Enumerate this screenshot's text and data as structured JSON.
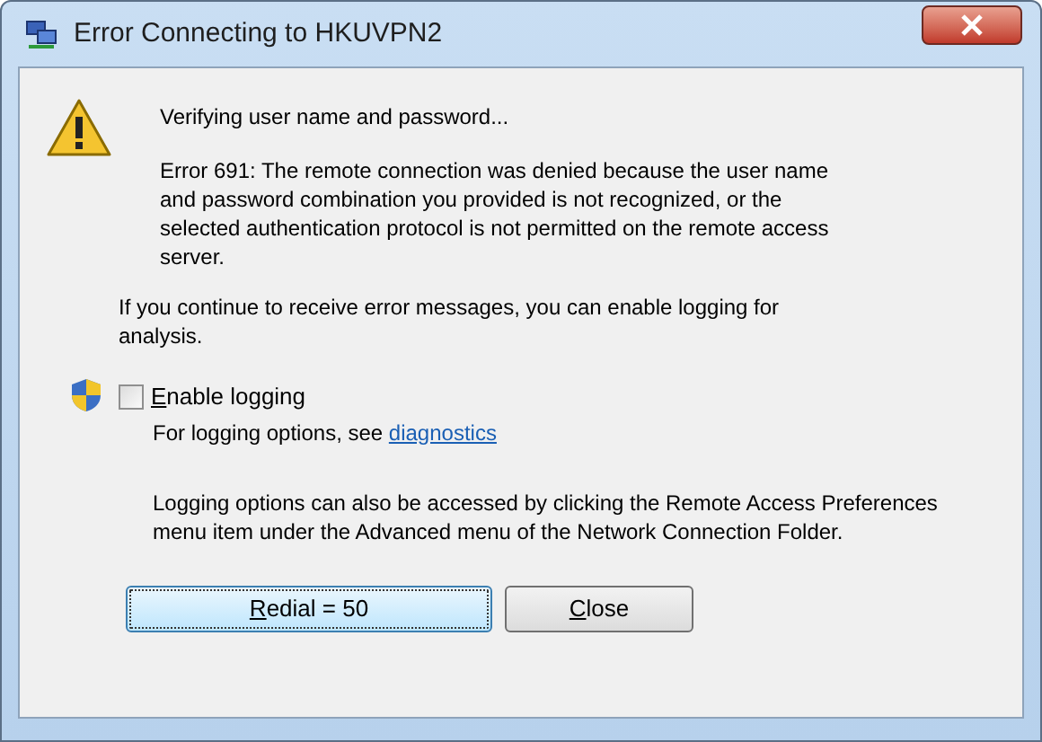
{
  "window": {
    "title": "Error Connecting to HKUVPN2"
  },
  "status": "Verifying user name and password...",
  "error": "Error 691: The remote connection was denied because the user name and password combination you provided is not recognized, or the selected authentication protocol is not permitted on the remote access server.",
  "hint": "If you continue to receive error messages, you can enable logging for analysis.",
  "logging": {
    "label": "Enable logging",
    "underlined_key": true,
    "checked": false,
    "options_text": "For logging options, see ",
    "link": "diagnostics"
  },
  "note": "Logging options can also be accessed by clicking the Remote Access Preferences menu item under the Advanced menu of the Network Connection Folder.",
  "buttons": [
    {
      "label": "Redial = 50",
      "underlined_key": true,
      "selected": true
    },
    {
      "label": "Close",
      "underlined_key": true,
      "selected": false
    }
  ]
}
